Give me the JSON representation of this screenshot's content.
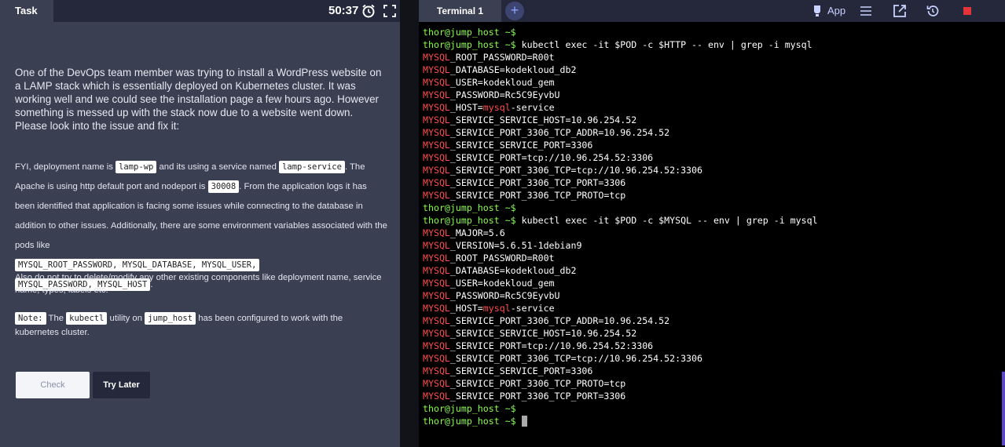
{
  "task": {
    "tab_label": "Task",
    "timer": "50:37",
    "intro": "One of the DevOps team member was trying to install a WordPress website on a LAMP stack which is essentially deployed on Kubernetes cluster. It was working well and we could see the installation page a few hours ago. However something is messed up with the stack now due to a website went down. Please look into the issue and fix it:",
    "fyi": {
      "t1": "FYI, deployment name is ",
      "c1": "lamp-wp",
      "t2": " and its using a service named ",
      "c2": "lamp-service",
      "t3": ". The Apache is using http default port and nodeport is ",
      "c3": "30008",
      "t4": ". From the application logs it has been identified that application is facing some issues while connecting to the database in addition to other issues. Additionally, there are some environment variables associated with the pods like ",
      "c4": "MYSQL_ROOT_PASSWORD, MYSQL_DATABASE, MYSQL_USER,",
      "c5": "MYSQL_PASSWORD, MYSQL_HOST",
      "t5": "."
    },
    "also": "Also do not try to delete/modify any other existing components like deployment name, service name, types, labels etc.",
    "note": {
      "label": "Note:",
      "t1": " The ",
      "c1": "kubectl",
      "t2": " utility on ",
      "c2": "jump_host",
      "t3": " has been configured to work with the",
      "t4": "kubernetes cluster."
    },
    "check_label": "Check",
    "try_later_label": "Try Later"
  },
  "terminal": {
    "tab_label": "Terminal 1",
    "add_tab": "+",
    "app_label": "App",
    "prompt": "thor@jump_host ~$",
    "highlight": "MYSQL",
    "lines": [
      {
        "type": "prompt",
        "text": ""
      },
      {
        "type": "prompt",
        "text": " kubectl exec -it $POD -c $HTTP -- env | grep -i mysql"
      },
      {
        "type": "env",
        "text": "_ROOT_PASSWORD=R00t"
      },
      {
        "type": "env",
        "text": "_DATABASE=kodekloud_db2"
      },
      {
        "type": "env",
        "text": "_USER=kodekloud_gem"
      },
      {
        "type": "env",
        "text": "_PASSWORD=Rc5C9EyvbU"
      },
      {
        "type": "env_host",
        "text": "_HOST=",
        "host": "mysql",
        "rest": "-service"
      },
      {
        "type": "env",
        "text": "_SERVICE_SERVICE_HOST=10.96.254.52"
      },
      {
        "type": "env",
        "text": "_SERVICE_PORT_3306_TCP_ADDR=10.96.254.52"
      },
      {
        "type": "env",
        "text": "_SERVICE_SERVICE_PORT=3306"
      },
      {
        "type": "env",
        "text": "_SERVICE_PORT=tcp://10.96.254.52:3306"
      },
      {
        "type": "env",
        "text": "_SERVICE_PORT_3306_TCP=tcp://10.96.254.52:3306"
      },
      {
        "type": "env",
        "text": "_SERVICE_PORT_3306_TCP_PORT=3306"
      },
      {
        "type": "env",
        "text": "_SERVICE_PORT_3306_TCP_PROTO=tcp"
      },
      {
        "type": "prompt",
        "text": ""
      },
      {
        "type": "prompt",
        "text": " kubectl exec -it $POD -c $MYSQL -- env | grep -i mysql"
      },
      {
        "type": "env",
        "text": "_MAJOR=5.6"
      },
      {
        "type": "env",
        "text": "_VERSION=5.6.51-1debian9"
      },
      {
        "type": "env",
        "text": "_ROOT_PASSWORD=R00t"
      },
      {
        "type": "env",
        "text": "_DATABASE=kodekloud_db2"
      },
      {
        "type": "env",
        "text": "_USER=kodekloud_gem"
      },
      {
        "type": "env",
        "text": "_PASSWORD=Rc5C9EyvbU"
      },
      {
        "type": "env_host",
        "text": "_HOST=",
        "host": "mysql",
        "rest": "-service"
      },
      {
        "type": "env",
        "text": "_SERVICE_PORT_3306_TCP_ADDR=10.96.254.52"
      },
      {
        "type": "env",
        "text": "_SERVICE_SERVICE_HOST=10.96.254.52"
      },
      {
        "type": "env",
        "text": "_SERVICE_PORT=tcp://10.96.254.52:3306"
      },
      {
        "type": "env",
        "text": "_SERVICE_PORT_3306_TCP=tcp://10.96.254.52:3306"
      },
      {
        "type": "env",
        "text": "_SERVICE_SERVICE_PORT=3306"
      },
      {
        "type": "env",
        "text": "_SERVICE_PORT_3306_TCP_PROTO=tcp"
      },
      {
        "type": "env",
        "text": "_SERVICE_PORT_3306_TCP_PORT=3306"
      },
      {
        "type": "prompt",
        "text": ""
      },
      {
        "type": "cursor",
        "text": " "
      }
    ]
  },
  "icons": {
    "timer": "alarm-clock-icon",
    "fullscreen": "fullscreen-icon",
    "app": "lightbulb-icon",
    "menu": "hamburger-menu-icon",
    "external": "external-link-icon",
    "refresh": "history-icon",
    "stop": "stop-icon"
  },
  "colors": {
    "prompt": "#8bff4b",
    "highlight": "#ff4d4d",
    "panel_bg": "#3a3f52",
    "header_bg": "#24283a",
    "stop": "#e5333a",
    "accent": "#5b49c8"
  }
}
